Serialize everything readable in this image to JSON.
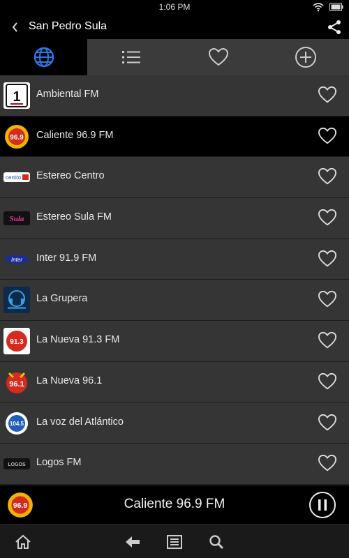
{
  "status_bar": {
    "time": "1:06 PM",
    "icons": [
      "wifi-icon",
      "battery-icon"
    ]
  },
  "header": {
    "title": "San Pedro Sula",
    "back_icon": "chevron-left-icon",
    "share_icon": "share-icon"
  },
  "tabs": [
    {
      "icon": "globe-icon",
      "active": true
    },
    {
      "icon": "list-icon",
      "active": false
    },
    {
      "icon": "heart-icon",
      "active": false
    },
    {
      "icon": "add-circle-icon",
      "active": false
    }
  ],
  "stations": [
    {
      "name": "Ambiental FM",
      "logo_text": "1"
    },
    {
      "name": "Caliente 96.9 FM",
      "logo_text": "96.9",
      "selected": true
    },
    {
      "name": "Estereo Centro",
      "logo_text": "centro"
    },
    {
      "name": "Estereo Sula FM",
      "logo_text": "Sula"
    },
    {
      "name": "Inter 91.9 FM",
      "logo_text": "Inter"
    },
    {
      "name": "La Grupera",
      "logo_text": ""
    },
    {
      "name": "La Nueva 91.3 FM",
      "logo_text": "91.3"
    },
    {
      "name": "La Nueva 96.1",
      "logo_text": "96.1"
    },
    {
      "name": "La voz del Atlántico",
      "logo_text": "104.5"
    },
    {
      "name": "Logos FM",
      "logo_text": "LOGOS"
    }
  ],
  "player": {
    "now_playing": "Caliente 96.9 FM",
    "logo_text": "96.9"
  },
  "bottom_nav": [
    "home-icon",
    "back-arrow-icon",
    "menu-icon",
    "search-icon"
  ],
  "colors": {
    "accent": "#1e6fe0",
    "background": "#353535",
    "selected": "#000000"
  }
}
